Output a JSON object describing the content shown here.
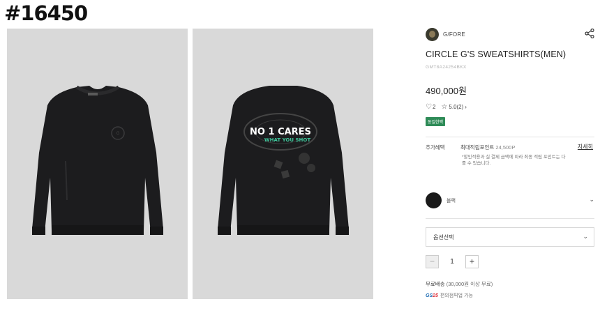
{
  "overlay": {
    "id_label": "#16450"
  },
  "images": {
    "front_alt": "front sweatshirt",
    "back_alt": "back sweatshirt",
    "back_print_line1": "NO 1 CARES",
    "back_print_line2": "WHAT YOU SHOT"
  },
  "product": {
    "brand": "G/FORE",
    "title": "CIRCLE G'S SWEATSHIRTS(MEN)",
    "code": "GMT8A24254BKX",
    "price": "490,000원",
    "likes": "2",
    "rating": "5.0",
    "reviews": "(2)",
    "badge": "동일한백"
  },
  "benefit": {
    "label": "추가혜택",
    "points_label": "최대적립포인트",
    "points_value": "24,500P",
    "detail_link": "자세히",
    "note": "*할인적용과 실 결제 금액에 따라 최종 적립 포인트는 다를 수 있습니다."
  },
  "option": {
    "color_name": "블랙",
    "select_label": "옵션선택"
  },
  "quantity": {
    "minus": "−",
    "value": "1",
    "plus": "+"
  },
  "shipping": {
    "label": "무료배송",
    "condition": "(30,000원 이상 무료)",
    "gs_logo_a": "GS",
    "gs_logo_b": "25",
    "gs_text": "편의점픽업 가능"
  },
  "icons": {
    "share": "share-icon",
    "heart": "heart-icon",
    "star": "star-icon",
    "chevron": "chevron-down-icon"
  },
  "colors": {
    "panel_bg": "#d9d9d9",
    "garment": "#1c1c1e",
    "badge": "#2e8b57",
    "print_green": "#3fc59a"
  }
}
